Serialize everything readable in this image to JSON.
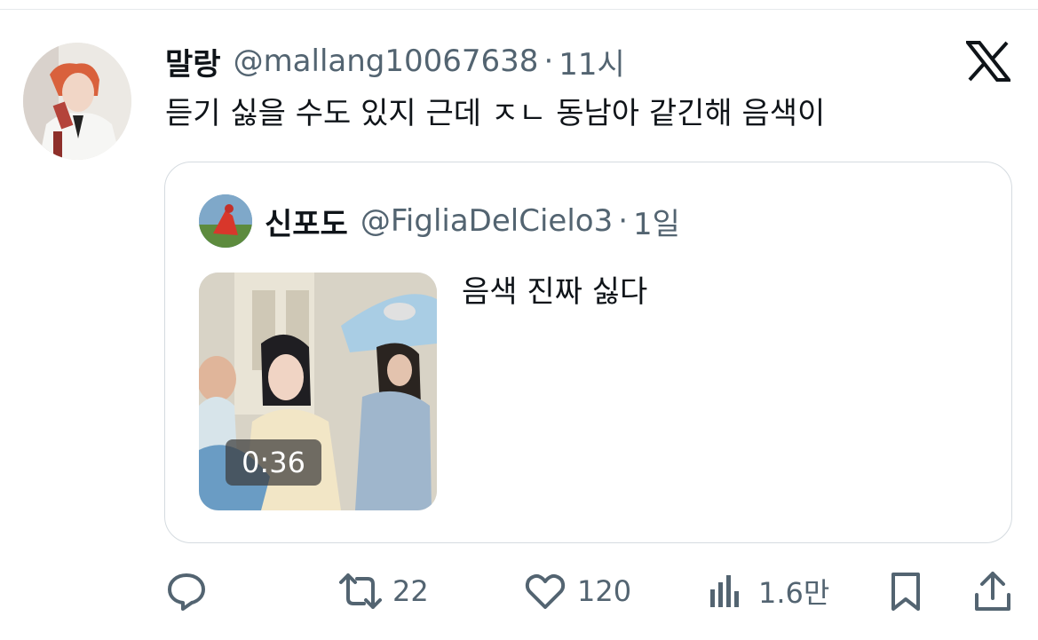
{
  "tweet": {
    "author": {
      "display_name": "말랑",
      "handle": "@mallang10067638"
    },
    "separator": "·",
    "time": "11시",
    "text": "듣기 싫을 수도 있지 근데 ㅈㄴ 동남아 같긴해 음색이"
  },
  "quote": {
    "author": {
      "display_name": "신포도",
      "handle": "@FigliaDelCielo3"
    },
    "separator": "·",
    "time": "1일",
    "text": "음색 진짜 싫다",
    "media": {
      "duration": "0:36"
    }
  },
  "actions": {
    "reply": {
      "icon": "reply-icon",
      "count": ""
    },
    "retweet": {
      "icon": "retweet-icon",
      "count": "22"
    },
    "like": {
      "icon": "heart-icon",
      "count": "120"
    },
    "views": {
      "icon": "views-icon",
      "count": "1.6만"
    },
    "bookmark": {
      "icon": "bookmark-icon",
      "count": ""
    },
    "share": {
      "icon": "share-icon",
      "count": ""
    }
  },
  "colors": {
    "text_primary": "#0f1419",
    "text_secondary": "#536471",
    "border": "#d5dbe0"
  }
}
